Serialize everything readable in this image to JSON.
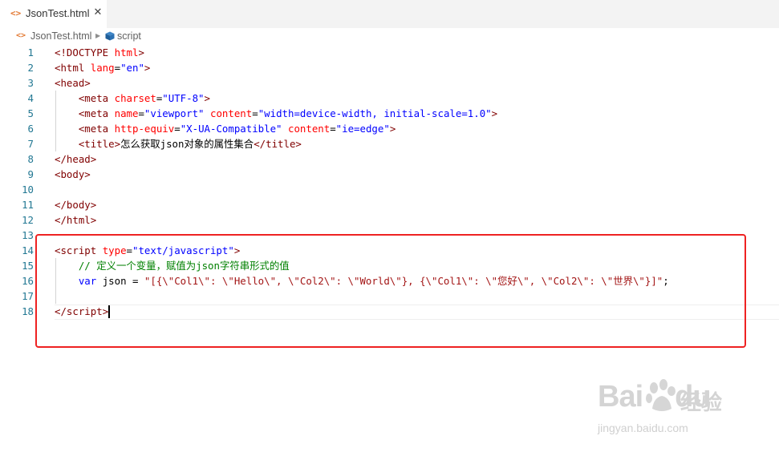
{
  "tab": {
    "file_name": "JsonTest.html",
    "close_glyph": "✕",
    "file_icon": "code-file-icon"
  },
  "breadcrumb": {
    "file": "JsonTest.html",
    "symbol": "script",
    "file_icon": "code-file-icon",
    "symbol_icon": "cube-icon"
  },
  "editor": {
    "lines": [
      {
        "n": "1",
        "segs": [
          [
            "tag",
            "<!DOCTYPE "
          ],
          [
            "attr",
            "html"
          ],
          [
            "tag",
            ">"
          ]
        ]
      },
      {
        "n": "2",
        "segs": [
          [
            "tag",
            "<html "
          ],
          [
            "attr",
            "lang"
          ],
          [
            "txt",
            "="
          ],
          [
            "str",
            "\"en\""
          ],
          [
            "tag",
            ">"
          ]
        ]
      },
      {
        "n": "3",
        "segs": [
          [
            "tag",
            "<head>"
          ]
        ]
      },
      {
        "n": "4",
        "segs": [
          [
            "txt",
            "    "
          ],
          [
            "tag",
            "<meta "
          ],
          [
            "attr",
            "charset"
          ],
          [
            "txt",
            "="
          ],
          [
            "str",
            "\"UTF-8\""
          ],
          [
            "tag",
            ">"
          ]
        ]
      },
      {
        "n": "5",
        "segs": [
          [
            "txt",
            "    "
          ],
          [
            "tag",
            "<meta "
          ],
          [
            "attr",
            "name"
          ],
          [
            "txt",
            "="
          ],
          [
            "str",
            "\"viewport\""
          ],
          [
            "txt",
            " "
          ],
          [
            "attr",
            "content"
          ],
          [
            "txt",
            "="
          ],
          [
            "str",
            "\"width=device-width, initial-scale=1.0\""
          ],
          [
            "tag",
            ">"
          ]
        ]
      },
      {
        "n": "6",
        "segs": [
          [
            "txt",
            "    "
          ],
          [
            "tag",
            "<meta "
          ],
          [
            "attr",
            "http-equiv"
          ],
          [
            "txt",
            "="
          ],
          [
            "str",
            "\"X-UA-Compatible\""
          ],
          [
            "txt",
            " "
          ],
          [
            "attr",
            "content"
          ],
          [
            "txt",
            "="
          ],
          [
            "str",
            "\"ie=edge\""
          ],
          [
            "tag",
            ">"
          ]
        ]
      },
      {
        "n": "7",
        "segs": [
          [
            "txt",
            "    "
          ],
          [
            "tag",
            "<title>"
          ],
          [
            "txt",
            "怎么获取json对象的属性集合"
          ],
          [
            "tag",
            "</title>"
          ]
        ]
      },
      {
        "n": "8",
        "segs": [
          [
            "tag",
            "</head>"
          ]
        ]
      },
      {
        "n": "9",
        "segs": [
          [
            "tag",
            "<body>"
          ]
        ]
      },
      {
        "n": "10",
        "segs": []
      },
      {
        "n": "11",
        "segs": [
          [
            "tag",
            "</body>"
          ]
        ]
      },
      {
        "n": "12",
        "segs": [
          [
            "tag",
            "</html>"
          ]
        ]
      },
      {
        "n": "13",
        "segs": []
      },
      {
        "n": "14",
        "segs": [
          [
            "tag",
            "<script "
          ],
          [
            "attr",
            "type"
          ],
          [
            "txt",
            "="
          ],
          [
            "str",
            "\"text/javascript\""
          ],
          [
            "tag",
            ">"
          ]
        ]
      },
      {
        "n": "15",
        "segs": [
          [
            "txt",
            "    "
          ],
          [
            "cmt",
            "// 定义一个变量，赋值为json字符串形式的值"
          ]
        ]
      },
      {
        "n": "16",
        "segs": [
          [
            "txt",
            "    "
          ],
          [
            "kw",
            "var"
          ],
          [
            "txt",
            " json = "
          ],
          [
            "jstr",
            "\"[{\\\"Col1\\\": \\\"Hello\\\", \\\"Col2\\\": \\\"World\\\"}, {\\\"Col1\\\": \\\"您好\\\", \\\"Col2\\\": \\\"世界\\\"}]\""
          ],
          [
            "txt",
            ";"
          ]
        ]
      },
      {
        "n": "17",
        "segs": []
      },
      {
        "n": "18",
        "segs": [
          [
            "tag",
            "</script"
          ],
          [
            "tag",
            ">"
          ]
        ]
      }
    ],
    "cursor_line": "18"
  },
  "watermark": {
    "logo_text": "Bai",
    "logo_text2": "du",
    "cn_text": "经验",
    "url": "jingyan.baidu.com"
  },
  "colors": {
    "tag": "#800000",
    "attribute": "#ff0000",
    "string": "#0000ff",
    "js_string": "#a31515",
    "keyword": "#0000ff",
    "comment": "#008000",
    "line_number": "#237893",
    "highlight_box": "#ee2222"
  }
}
